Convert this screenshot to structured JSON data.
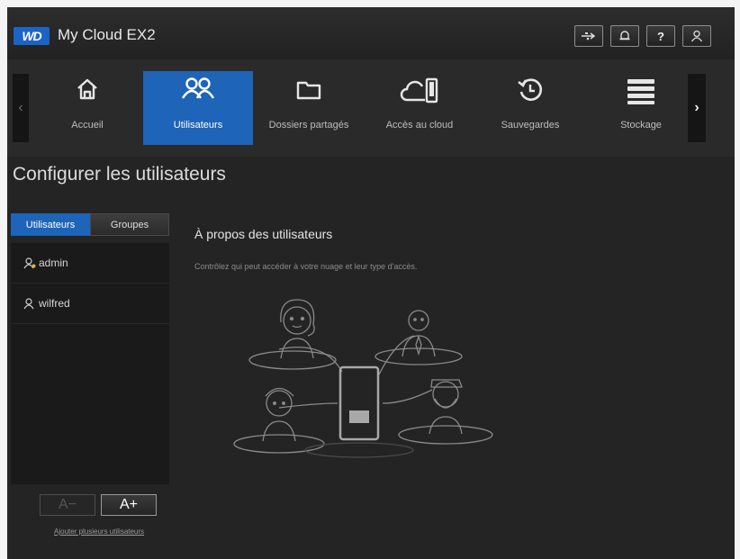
{
  "app": {
    "logo_text": "WD",
    "product_name": "My Cloud EX2",
    "accent_color": "#1e64b8"
  },
  "top_icons": [
    {
      "name": "usb-icon"
    },
    {
      "name": "bell-icon"
    },
    {
      "name": "help-icon"
    },
    {
      "name": "user-icon"
    }
  ],
  "nav": {
    "items": [
      {
        "label": "Accueil",
        "icon": "home-icon",
        "active": false
      },
      {
        "label": "Utilisateurs",
        "icon": "users-icon",
        "active": true
      },
      {
        "label": "Dossiers partagés",
        "icon": "folder-icon",
        "active": false
      },
      {
        "label": "Accès au cloud",
        "icon": "cloud-device-icon",
        "active": false
      },
      {
        "label": "Sauvegardes",
        "icon": "backup-icon",
        "active": false
      },
      {
        "label": "Stockage",
        "icon": "storage-icon",
        "active": false
      }
    ]
  },
  "page": {
    "title": "Configurer les utilisateurs"
  },
  "left_panel": {
    "tabs": [
      {
        "label": "Utilisateurs",
        "active": true
      },
      {
        "label": "Groupes",
        "active": false
      }
    ],
    "users": [
      {
        "name": "admin"
      },
      {
        "name": "wilfred"
      }
    ],
    "remove_button_symbol": "A−",
    "add_button_symbol": "A+",
    "add_multiple_link": "Ajouter plusieurs utilisateurs"
  },
  "about": {
    "title": "À propos des utilisateurs",
    "description": "Contrôlez qui peut accéder à votre nuage et leur type d'accès."
  }
}
